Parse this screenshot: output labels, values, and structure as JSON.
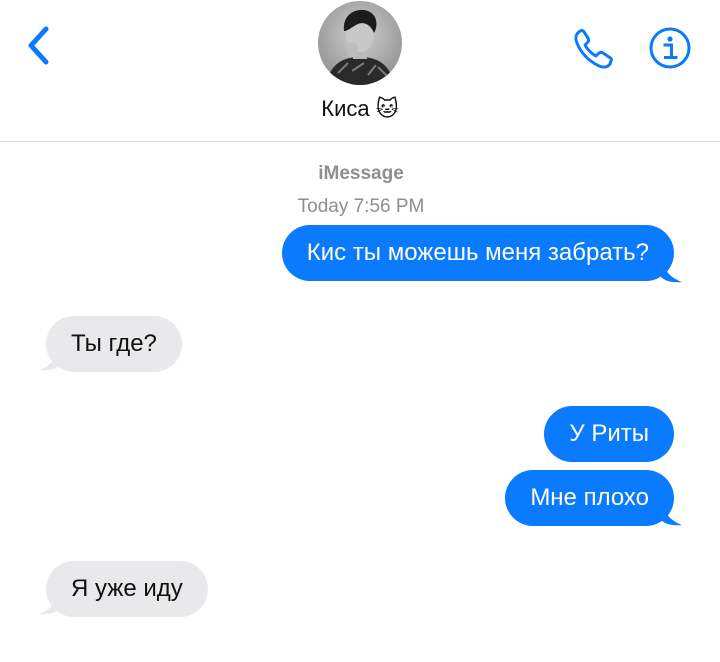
{
  "header": {
    "contact_name": "Киса 🐱",
    "back_icon": "chevron-left-icon",
    "phone_icon": "phone-icon",
    "info_icon": "info-icon"
  },
  "thread": {
    "service": "iMessage",
    "timestamp": "Today 7:56 PM"
  },
  "messages": [
    {
      "direction": "sent",
      "text": "Кис ты можешь меня забрать?"
    },
    {
      "direction": "received",
      "text": "Ты где?"
    },
    {
      "direction": "sent",
      "text": "У Риты"
    },
    {
      "direction": "sent",
      "text": "Мне плохо"
    },
    {
      "direction": "received",
      "text": "Я уже иду"
    }
  ],
  "colors": {
    "accent": "#0a7aff",
    "sent_bubble": "#0a7aff",
    "received_bubble": "#e9e9eb",
    "meta_text": "#8e8e93"
  }
}
